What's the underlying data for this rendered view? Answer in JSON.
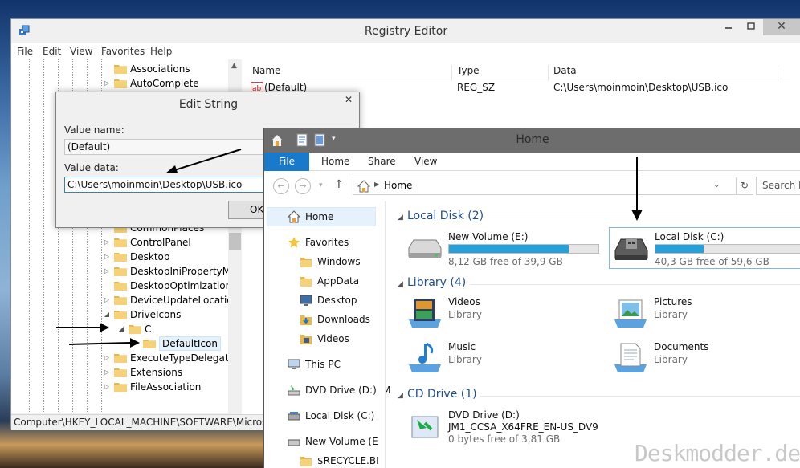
{
  "registry": {
    "title": "Registry Editor",
    "menu": [
      "File",
      "Edit",
      "View",
      "Favorites",
      "Help"
    ],
    "tree": [
      {
        "label": "Associations",
        "expander": ""
      },
      {
        "label": "AutoComplete",
        "expander": "▷"
      },
      {
        "label": "CommonPlaces",
        "expander": ""
      },
      {
        "label": "ControlPanel",
        "expander": "▷"
      },
      {
        "label": "Desktop",
        "expander": "▷"
      },
      {
        "label": "DesktopIniPropertyMap",
        "expander": "▷"
      },
      {
        "label": "DesktopOptimization",
        "expander": ""
      },
      {
        "label": "DeviceUpdateLocations",
        "expander": "▷"
      },
      {
        "label": "DriveIcons",
        "expander": "◢"
      },
      {
        "label": "C",
        "expander": "◢"
      },
      {
        "label": "DefaultIcon",
        "expander": ""
      },
      {
        "label": "ExecuteTypeDelegates",
        "expander": "▷"
      },
      {
        "label": "Extensions",
        "expander": "▷"
      },
      {
        "label": "FileAssociation",
        "expander": "▷"
      }
    ],
    "columns": [
      "Name",
      "Type",
      "Data"
    ],
    "rows": [
      {
        "icon": "ab",
        "name": "(Default)",
        "type": "REG_SZ",
        "data": "C:\\Users\\moinmoin\\Desktop\\USB.ico"
      }
    ],
    "status": "Computer\\HKEY_LOCAL_MACHINE\\SOFTWARE\\Microsoft\\Windows\\CurrentVersion\\Explorer\\DriveIcons\\C\\DefaultIcon"
  },
  "dialog": {
    "title": "Edit String",
    "value_name_label": "Value name:",
    "value_name": "(Default)",
    "value_data_label": "Value data:",
    "value_data": "C:\\Users\\moinmoin\\Desktop\\USB.ico",
    "ok_label": "OK"
  },
  "explorer": {
    "title": "Home",
    "ribbon_tabs": [
      "File",
      "Home",
      "Share",
      "View"
    ],
    "address": "Home",
    "search_placeholder": "Search H",
    "nav": [
      {
        "label": "Home",
        "icon": "home-icon"
      },
      {
        "label": "Favorites",
        "icon": "star-icon"
      },
      {
        "label": "Windows",
        "icon": "folder-icon"
      },
      {
        "label": "AppData",
        "icon": "folder-icon"
      },
      {
        "label": "Desktop",
        "icon": "desktop-icon"
      },
      {
        "label": "Downloads",
        "icon": "downloads-icon"
      },
      {
        "label": "Videos",
        "icon": "videos-icon"
      },
      {
        "label": "This PC",
        "icon": "computer-icon"
      },
      {
        "label": "DVD Drive (D:) JM",
        "icon": "dvd-icon"
      },
      {
        "label": "Local Disk (C:)",
        "icon": "disk-icon"
      },
      {
        "label": "New Volume (E:)",
        "icon": "disk-icon"
      },
      {
        "label": "$RECYCLE.BIN",
        "icon": "folder-icon"
      }
    ],
    "groups": {
      "local_disk": "Local Disk (2)",
      "library": "Library (4)",
      "cd_drive": "CD Drive (1)"
    },
    "drives": [
      {
        "name": "New Volume (E:)",
        "free": "8,12 GB free of 39,9 GB",
        "used_fraction": 0.8
      },
      {
        "name": "Local Disk (C:)",
        "free": "40,3 GB free of 59,6 GB",
        "used_fraction": 0.32
      }
    ],
    "libraries": [
      {
        "name": "Videos",
        "sub": "Library",
        "icon": "videos-library-icon"
      },
      {
        "name": "Pictures",
        "sub": "Library",
        "icon": "pictures-library-icon"
      },
      {
        "name": "Music",
        "sub": "Library",
        "icon": "music-library-icon"
      },
      {
        "name": "Documents",
        "sub": "Library",
        "icon": "documents-library-icon"
      }
    ],
    "cd": {
      "name": "DVD Drive (D:)",
      "label": "JM1_CCSA_X64FRE_EN-US_DV9",
      "free": "0 bytes free of 3,81 GB"
    }
  },
  "watermark": "Deskmodder.de",
  "colors": {
    "accent": "#1979ca",
    "bar": "#26a0da",
    "group_text": "#1e4f8f"
  }
}
